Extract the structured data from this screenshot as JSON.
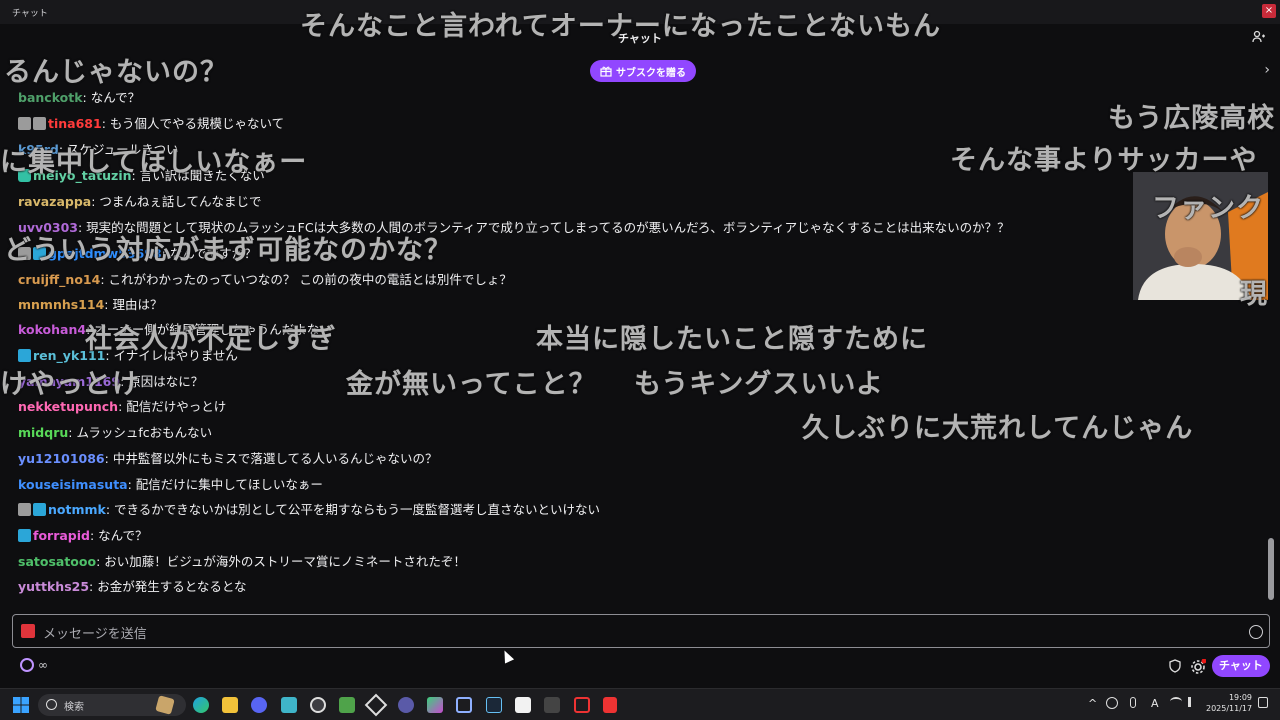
{
  "window": {
    "title": "チャット",
    "close_label": "×"
  },
  "header": {
    "title": "チャット",
    "sub_button": "サブスクを贈る",
    "next_arrow": "›"
  },
  "messages": [
    {
      "user": "banckotk",
      "color": "#4fa06a",
      "badges": [],
      "text": ": なんで？"
    },
    {
      "user": "tina681",
      "color": "#ff3b3b",
      "badges": [
        "mod",
        "mod"
      ],
      "text": ": もう個人でやる規模じゃないて"
    },
    {
      "user": "k95rd",
      "color": "#5b9bd5",
      "badges": [],
      "text": ": スケジュールきつい"
    },
    {
      "user": "meiyo_tatuzin",
      "color": "#62d0a4",
      "badges": [
        "prime"
      ],
      "text": ": 言い訳は聞きたくない"
    },
    {
      "user": "ravazappa",
      "color": "#d8b86a",
      "badges": [],
      "text": ": つまんねぇ話してんなまじで"
    },
    {
      "user": "uvv0303",
      "color": "#b06ad8",
      "badges": [],
      "text": ": 現実的な問題として現状のムラッシュFCは大多数の人間のボランティアで成り立ってしまってるのが悪いんだろ、ボランティアじゃなくすることは出来ないのか？？"
    },
    {
      "user": "gpajtdmw53698",
      "color": "#2f8fff",
      "badges": [
        "mod",
        "sub"
      ],
      "text": ": なんでですか？"
    },
    {
      "user": "cruijff_no14",
      "color": "#d89a4f",
      "badges": [],
      "text": ": これがわかったのっていつなの？ この前の夜中の電話とは別件でしょ？"
    },
    {
      "user": "mnmnhs114",
      "color": "#d8a04f",
      "badges": [],
      "text": ": 理由は？"
    },
    {
      "user": "kokohan4",
      "color": "#c75bd8",
      "badges": [],
      "text": ": オーナー側が結局管理しちゃうんだよな"
    },
    {
      "user": "ren_yk111",
      "color": "#5bbfd8",
      "badges": [
        "sub"
      ],
      "text": ": イナイレはやりません"
    },
    {
      "user": "yamayam1169",
      "color": "#9b6ad8",
      "badges": [],
      "text": ": 原因はなに？"
    },
    {
      "user": "nekketupunch",
      "color": "#ff69b4",
      "badges": [],
      "text": ": 配信だけやっとけ"
    },
    {
      "user": "midqru",
      "color": "#58d858",
      "badges": [],
      "text": ": ムラッシュfcおもんない"
    },
    {
      "user": "yu12101086",
      "color": "#6a8fff",
      "badges": [],
      "text": ": 中井監督以外にもミスで落選してる人いるんじゃないの？"
    },
    {
      "user": "kouseisimasuta",
      "color": "#3f8fff",
      "badges": [],
      "text": ": 配信だけに集中してほしいなぁー"
    },
    {
      "user": "notmmk",
      "color": "#4aa8ff",
      "badges": [
        "mod",
        "sub"
      ],
      "text": ": できるかできないかは別として公平を期すならもう一度監督選考し直さないといけない"
    },
    {
      "user": "forrapid",
      "color": "#e85bd8",
      "badges": [
        "sub"
      ],
      "text": ": なんで？"
    },
    {
      "user": "satosatooo",
      "color": "#4fc06a",
      "badges": [],
      "text": ": おい加藤！ビジュが海外のストリーマ賞にノミネートされたぞ！"
    },
    {
      "user": "yuttkhs25",
      "color": "#c98bd8",
      "badges": [],
      "text": ": お金が発生するとなるとな"
    }
  ],
  "danmaku": [
    "そんなこと言われてオーナーになったことないもん",
    "るんじゃないの？",
    "もう広陵高校",
    "に集中してほしいなぁー",
    "そんな事よりサッカーや",
    "ファンク",
    "どういう対応がまず可能なのかな？",
    "現",
    "社会人が不足しすぎ",
    "本当に隠したいこと隠すために",
    "けやっとけ",
    "金が無いってこと？",
    "もうキングスいいよ",
    "久しぶりに大荒れしてんじゃん"
  ],
  "input": {
    "placeholder": "メッセージを送信"
  },
  "footer": {
    "points": "∞",
    "chat_button": "チャット"
  },
  "taskbar": {
    "search_placeholder": "検索",
    "time": "19:09",
    "date": "2025/11/17",
    "lang": "A"
  },
  "colors": {
    "accent": "#9147ff",
    "background": "#0e0e10"
  }
}
